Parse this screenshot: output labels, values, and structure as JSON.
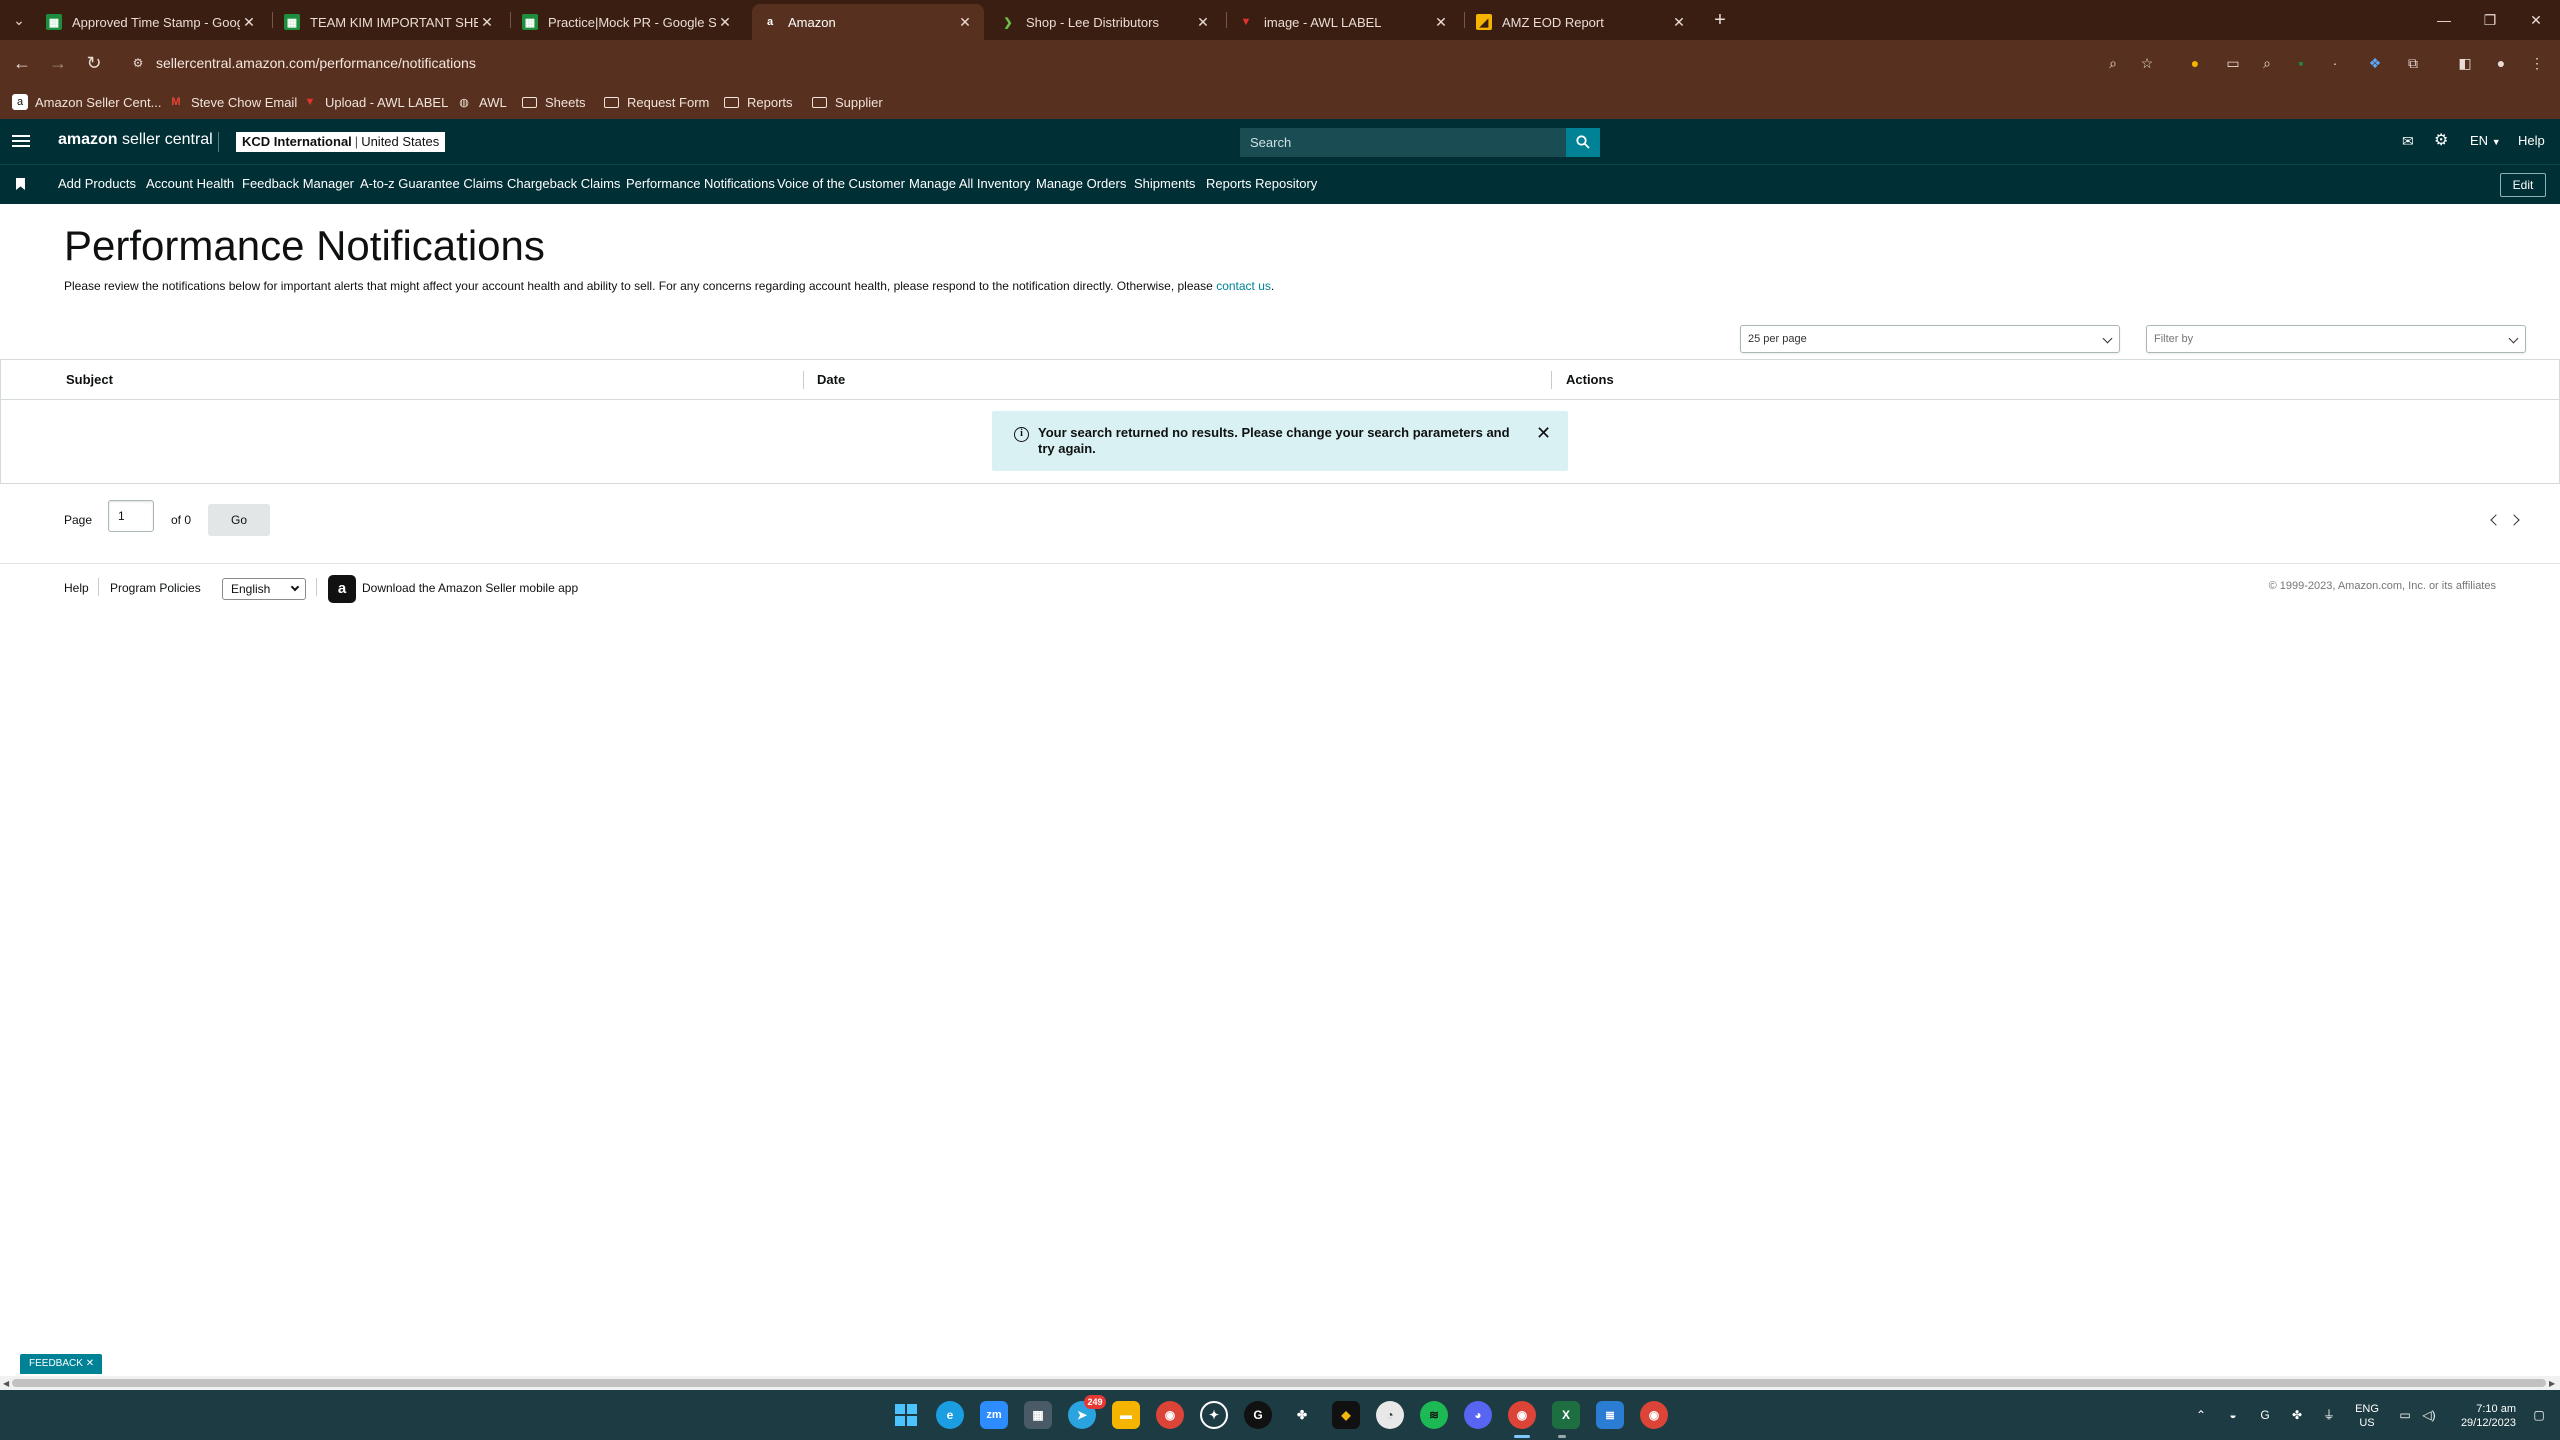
{
  "browser": {
    "tabs": [
      {
        "title": "Approved Time Stamp - Google Sheets",
        "favicon": "sheets-icon"
      },
      {
        "title": "TEAM KIM IMPORTANT SHEETS",
        "favicon": "sheets-icon"
      },
      {
        "title": "Practice|Mock PR - Google Sheets",
        "favicon": "sheets-icon"
      },
      {
        "title": "Amazon",
        "favicon": "amazon-icon",
        "active": true
      },
      {
        "title": "Shop - Lee Distributors",
        "favicon": "leaf-icon"
      },
      {
        "title": "image - AWL LABEL",
        "favicon": "awl-icon"
      },
      {
        "title": "AMZ EOD Report",
        "favicon": "report-icon"
      }
    ],
    "url": "sellercentral.amazon.com/performance/notifications",
    "bookmarks": [
      {
        "label": "Amazon Seller Cent...",
        "icon": "amazon-icon"
      },
      {
        "label": "Steve Chow Email",
        "icon": "gmail-icon"
      },
      {
        "label": "Upload - AWL LABEL",
        "icon": "awl-icon"
      },
      {
        "label": "AWL",
        "icon": "globe-icon"
      },
      {
        "label": "Sheets",
        "icon": "folder-icon"
      },
      {
        "label": "Request Form",
        "icon": "folder-icon"
      },
      {
        "label": "Reports",
        "icon": "folder-icon"
      },
      {
        "label": "Supplier",
        "icon": "folder-icon"
      }
    ]
  },
  "header": {
    "logo_amazon": "amazon",
    "logo_rest": " seller central",
    "account_name": "KCD International",
    "account_region": "United States",
    "search_placeholder": "Search",
    "language": "EN",
    "help": "Help"
  },
  "nav": {
    "items": [
      "Add Products",
      "Account Health",
      "Feedback Manager",
      "A-to-z Guarantee Claims",
      "Chargeback Claims",
      "Performance Notifications",
      "Voice of the Customer",
      "Manage All Inventory",
      "Manage Orders",
      "Shipments",
      "Reports Repository"
    ],
    "edit": "Edit"
  },
  "main": {
    "title": "Performance Notifications",
    "description": "Please review the notifications below for important alerts that might affect your account health and ability to sell. For any concerns regarding account health, please respond to the notification directly. Otherwise, please ",
    "contact_link": "contact us",
    "description_end": ".",
    "per_page": "25 per page",
    "filter_placeholder": "Filter by",
    "columns": [
      "Subject",
      "Date",
      "Actions"
    ],
    "alert": "Your search returned no results. Please change your search parameters and try again.",
    "pagination": {
      "page_label": "Page",
      "page_value": "1",
      "of_label": "of 0",
      "go": "Go"
    }
  },
  "footer": {
    "help": "Help",
    "policies": "Program Policies",
    "language": "English",
    "app_link": "Download the Amazon Seller mobile app",
    "copyright": "© 1999-2023, Amazon.com, Inc. or its affiliates"
  },
  "feedback": "FEEDBACK",
  "taskbar": {
    "lang_top": "ENG",
    "lang_bottom": "US",
    "time": "7:10 am",
    "date": "29/12/2023",
    "telegram_badge": "249"
  },
  "colors": {
    "header_bg": "#002f36",
    "accent": "#008296",
    "browser_bg": "#57301f"
  }
}
